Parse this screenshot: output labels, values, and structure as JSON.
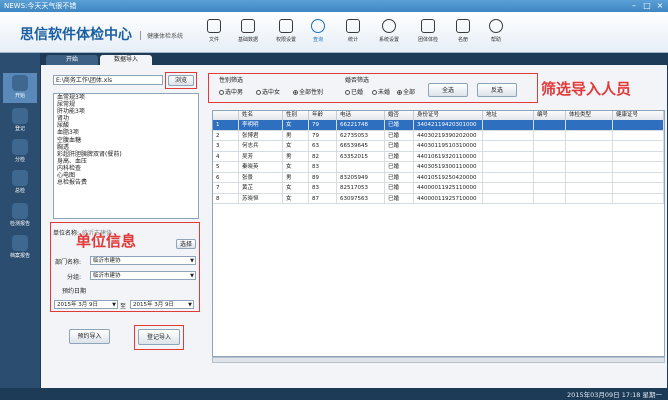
{
  "window": {
    "title": "NEWS:今天天气很不错"
  },
  "header": {
    "app_title": "思信软件体检中心",
    "subtitle": "健康体检系统",
    "tools": [
      {
        "label": "文件",
        "icon": "file-icon"
      },
      {
        "label": "基础数据",
        "icon": "database-icon"
      },
      {
        "label": "权限设置",
        "icon": "permission-icon"
      },
      {
        "label": "查询",
        "icon": "search-icon"
      },
      {
        "label": "统计",
        "icon": "statistics-icon"
      },
      {
        "label": "系统设置",
        "icon": "gear-icon"
      },
      {
        "label": "团体体检",
        "icon": "group-icon"
      },
      {
        "label": "名册",
        "icon": "roster-icon"
      },
      {
        "label": "帮助",
        "icon": "help-icon"
      }
    ]
  },
  "leftnav": [
    {
      "label": "开始"
    },
    {
      "label": "登记"
    },
    {
      "label": "分检"
    },
    {
      "label": "总检"
    },
    {
      "label": "检测报告"
    },
    {
      "label": "档案报告"
    }
  ],
  "tabs": [
    {
      "label": "开始"
    },
    {
      "label": "数据导入"
    }
  ],
  "import": {
    "file_path": "E:\\商务工作\\团体.xls",
    "browse_label": "浏览",
    "items": [
      "血常规3项",
      "尿常规",
      "肝功能3项",
      "肾功",
      "尿酸",
      "血脂3项",
      "空腹血糖",
      "胸透",
      "彩超肝胆胰脾双肾(餐前)",
      "身高、血压",
      "内科检查",
      "心电图",
      "总检报告费"
    ],
    "unit_label": "单位名称:",
    "unit_value": "临沂市建协",
    "select_label": "选择",
    "dept_label": "部门名称:",
    "dept_value": "临沂市建协",
    "group_label": "分组:",
    "group_value": "临沂市建协",
    "date_label": "预约日期",
    "date_from": "2015年 3月 9日",
    "date_sep": "至",
    "date_to": "2015年 3月 9日",
    "reserve_label": "预约导入",
    "register_label": "登记导入"
  },
  "annotations": {
    "unit_info": "单位信息",
    "filter_people": "筛选导入人员"
  },
  "filter": {
    "gender_title": "性别筛选",
    "gender_options": [
      "选中男",
      "选中女",
      "全部性别"
    ],
    "marriage_title": "婚否筛选",
    "marriage_options": [
      "已婚",
      "未婚",
      "全部"
    ],
    "select_all": "全选",
    "invert": "反选"
  },
  "table": {
    "headers": [
      "",
      "姓名",
      "性别",
      "年龄",
      "电话",
      "婚否",
      "身份证号",
      "地址",
      "编号",
      "体检类型",
      "健康证号"
    ],
    "rows": [
      {
        "idx": "1",
        "name": "李明明",
        "sex": "女",
        "age": "79",
        "phone": "66221748",
        "married": "已婚",
        "id": "34042119420301000"
      },
      {
        "idx": "2",
        "name": "张博君",
        "sex": "男",
        "age": "79",
        "phone": "62735053",
        "married": "已婚",
        "id": "44030219390202000"
      },
      {
        "idx": "3",
        "name": "何志兵",
        "sex": "女",
        "age": "63",
        "phone": "66539645",
        "married": "已婚",
        "id": "44030119510310000"
      },
      {
        "idx": "4",
        "name": "吴芳",
        "sex": "男",
        "age": "82",
        "phone": "63352015",
        "married": "已婚",
        "id": "44010619320110000"
      },
      {
        "idx": "5",
        "name": "秦晓英",
        "sex": "女",
        "age": "83",
        "phone": "",
        "married": "已婚",
        "id": "44030519300110000"
      },
      {
        "idx": "6",
        "name": "张景",
        "sex": "男",
        "age": "89",
        "phone": "83205949",
        "married": "已婚",
        "id": "44010519250420000"
      },
      {
        "idx": "7",
        "name": "黄芷",
        "sex": "女",
        "age": "83",
        "phone": "82517053",
        "married": "已婚",
        "id": "44000011925110000"
      },
      {
        "idx": "8",
        "name": "苏晓恒",
        "sex": "女",
        "age": "87",
        "phone": "63097563",
        "married": "已婚",
        "id": "44000011925710000"
      }
    ]
  },
  "status": {
    "time": "2015年03月09日 17:18 星期一"
  }
}
